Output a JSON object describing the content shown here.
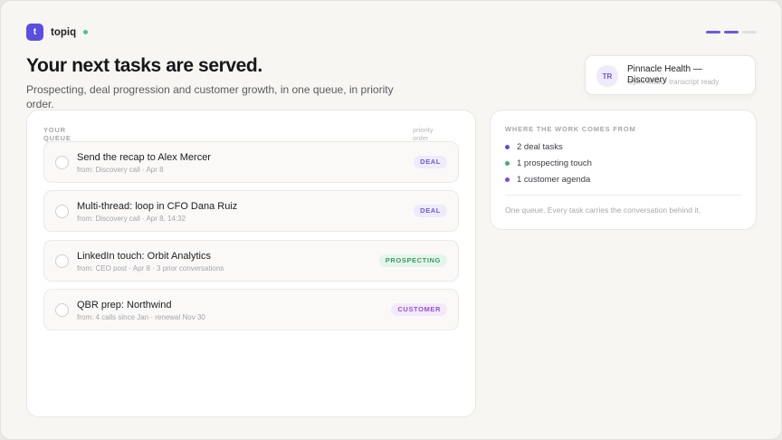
{
  "app": {
    "logo_letter": "t",
    "name": "topiq"
  },
  "progress": {
    "total_steps": 3,
    "active_steps": 2
  },
  "hero": {
    "title": "Your next tasks are served.",
    "subtitle": "Prospecting, deal progression and customer growth, in one queue, in priority order."
  },
  "toast": {
    "initials": "TR",
    "title": "Pinnacle Health — Discovery",
    "subtitle": "Open Main · transcript ready"
  },
  "queue": {
    "label": "YOUR QUEUE",
    "sort_label": "priority order",
    "tasks": [
      {
        "title": "Send the recap to Alex Mercer",
        "meta": "from: Discovery call · Apr 8",
        "tag": "DEAL",
        "tag_kind": "deal"
      },
      {
        "title": "Multi-thread: loop in CFO Dana Ruiz",
        "meta": "from: Discovery call · Apr 8, 14:32",
        "tag": "DEAL",
        "tag_kind": "deal"
      },
      {
        "title": "LinkedIn touch: Orbit Analytics",
        "meta": "from: CEO post · Apr 8 · 3 prior conversations",
        "tag": "PROSPECTING",
        "tag_kind": "prospecting"
      },
      {
        "title": "QBR prep: Northwind",
        "meta": "from: 4 calls since Jan · renewal Nov 30",
        "tag": "CUSTOMER",
        "tag_kind": "customer"
      }
    ]
  },
  "sources": {
    "label": "WHERE THE WORK COMES FROM",
    "items": [
      {
        "text": "2 deal tasks",
        "color": "#5b4ee0"
      },
      {
        "text": "1 prospecting touch",
        "color": "#3fae6e"
      },
      {
        "text": "1 customer agenda",
        "color": "#8b46d6"
      }
    ],
    "footer": "One queue. Every task carries the conversation behind it."
  },
  "colors": {
    "accent": "#5b4ee0",
    "status_online": "#4cc38a"
  }
}
